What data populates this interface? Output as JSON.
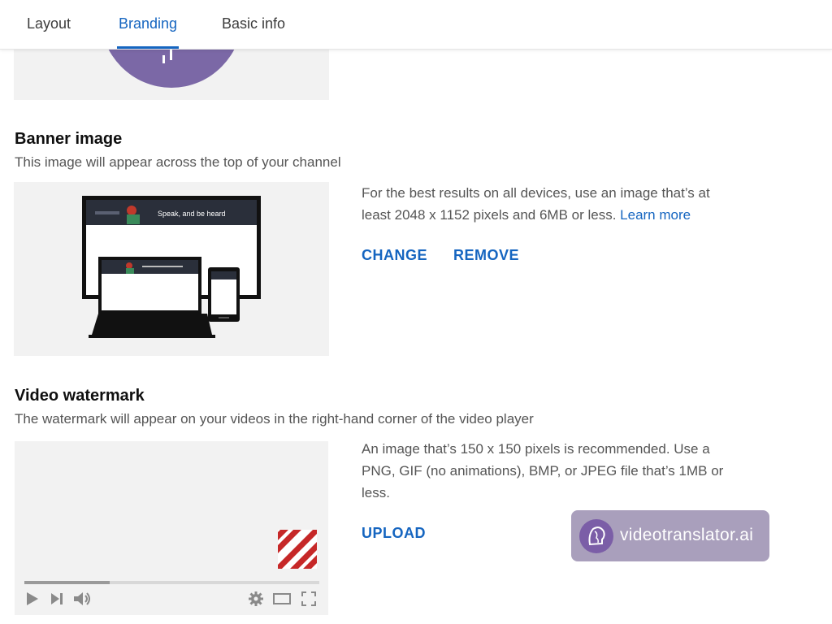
{
  "tabs": [
    {
      "label": "Layout"
    },
    {
      "label": "Branding"
    },
    {
      "label": "Basic info"
    }
  ],
  "active_tab": "Branding",
  "banner": {
    "title": "Banner image",
    "description": "This image will appear across the top of your channel",
    "preview_text": "Speak, and be heard",
    "info_text": "For the best results on all devices, use an image that’s at least 2048 x 1152 pixels and 6MB or less.",
    "learn_more": "Learn more",
    "change_label": "CHANGE",
    "remove_label": "REMOVE"
  },
  "watermark": {
    "title": "Video watermark",
    "description": "The watermark will appear on your videos in the right-hand corner of the video player",
    "info_text": "An image that’s 150 x 150 pixels is recommended. Use a PNG, GIF (no animations), BMP, or JPEG file that’s 1MB or less.",
    "upload_label": "UPLOAD",
    "progress_fraction": 0.29
  },
  "overlay_brand": {
    "text": "videotranslator.ai"
  },
  "colors": {
    "accent": "#1565c0",
    "avatar_purple": "#7b68a6",
    "watermark_red": "#c62828",
    "brand_badge": "#a99fbc"
  }
}
